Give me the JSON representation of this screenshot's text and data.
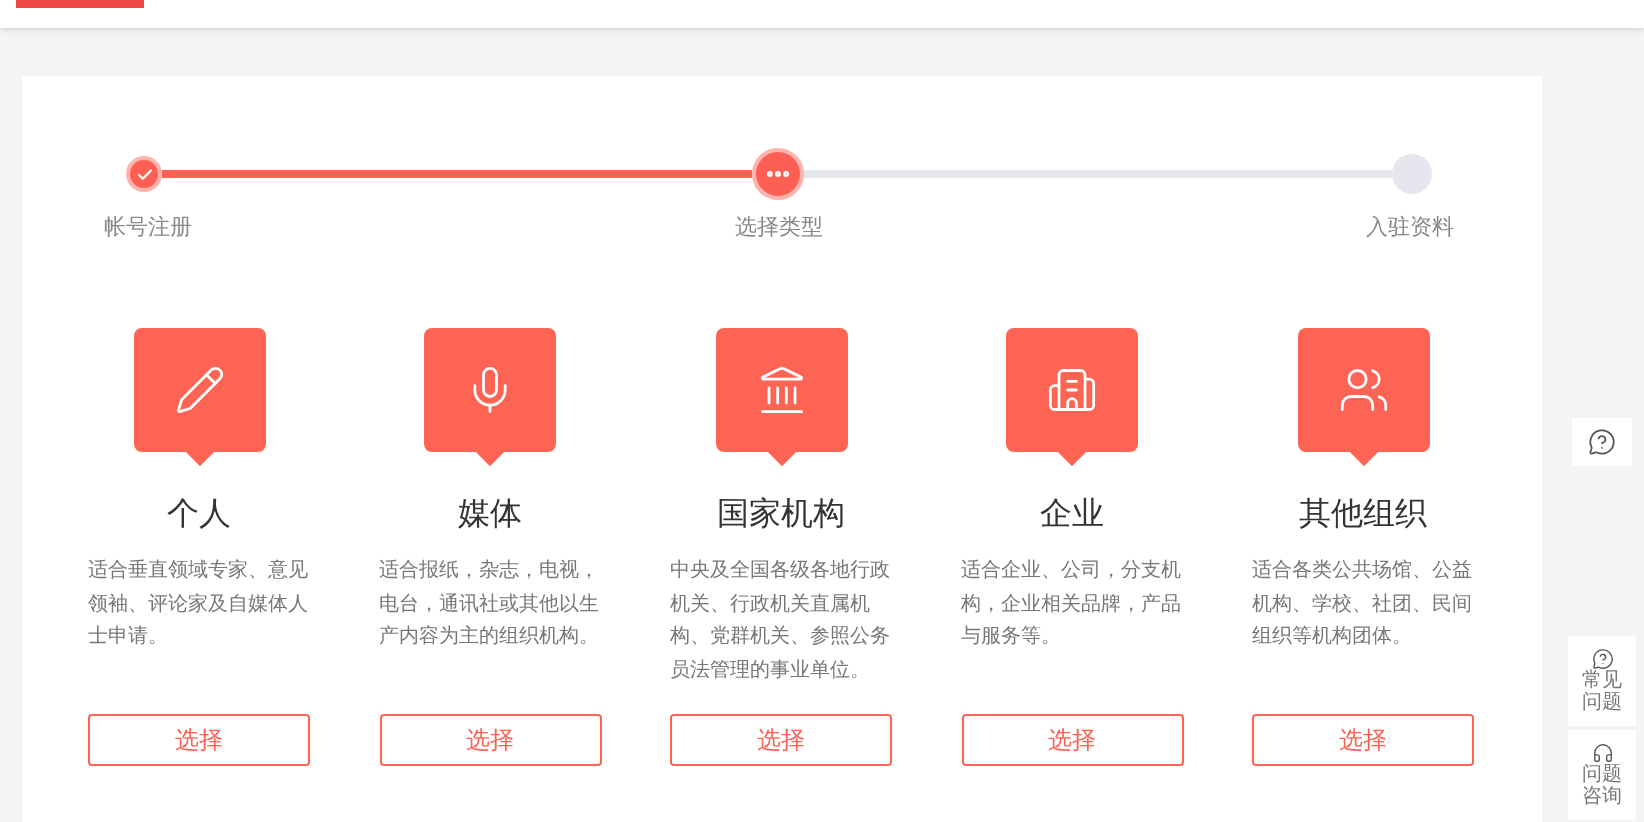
{
  "steps": [
    {
      "label": "帐号注册",
      "kind": "done"
    },
    {
      "label": "选择类型",
      "kind": "current"
    },
    {
      "label": "入驻资料",
      "kind": "pending"
    }
  ],
  "types": [
    {
      "kind": "person",
      "title": "个人",
      "description": "适合垂直领域专家、意见领袖、评论家及自媒体人士申请。",
      "button": "选择"
    },
    {
      "kind": "media",
      "title": "媒体",
      "description": "适合报纸，杂志，电视，电台，通讯社或其他以生产内容为主的组织机构。",
      "button": "选择"
    },
    {
      "kind": "government",
      "title": "国家机构",
      "description": "中央及全国各级各地行政机关、行政机关直属机构、党群机关、参照公务员法管理的事业单位。",
      "button": "选择"
    },
    {
      "kind": "enterprise",
      "title": "企业",
      "description": "适合企业、公司，分支机构，企业相关品牌，产品与服务等。",
      "button": "选择"
    },
    {
      "kind": "organization",
      "title": "其他组织",
      "description": "适合各类公共场馆、公益机构、学校、社团、民间组织等机构团体。",
      "button": "选择"
    }
  ],
  "side_buttons": [
    {
      "kind": "faq",
      "label": "常见问题"
    },
    {
      "kind": "consult",
      "label": "问题咨询"
    }
  ]
}
